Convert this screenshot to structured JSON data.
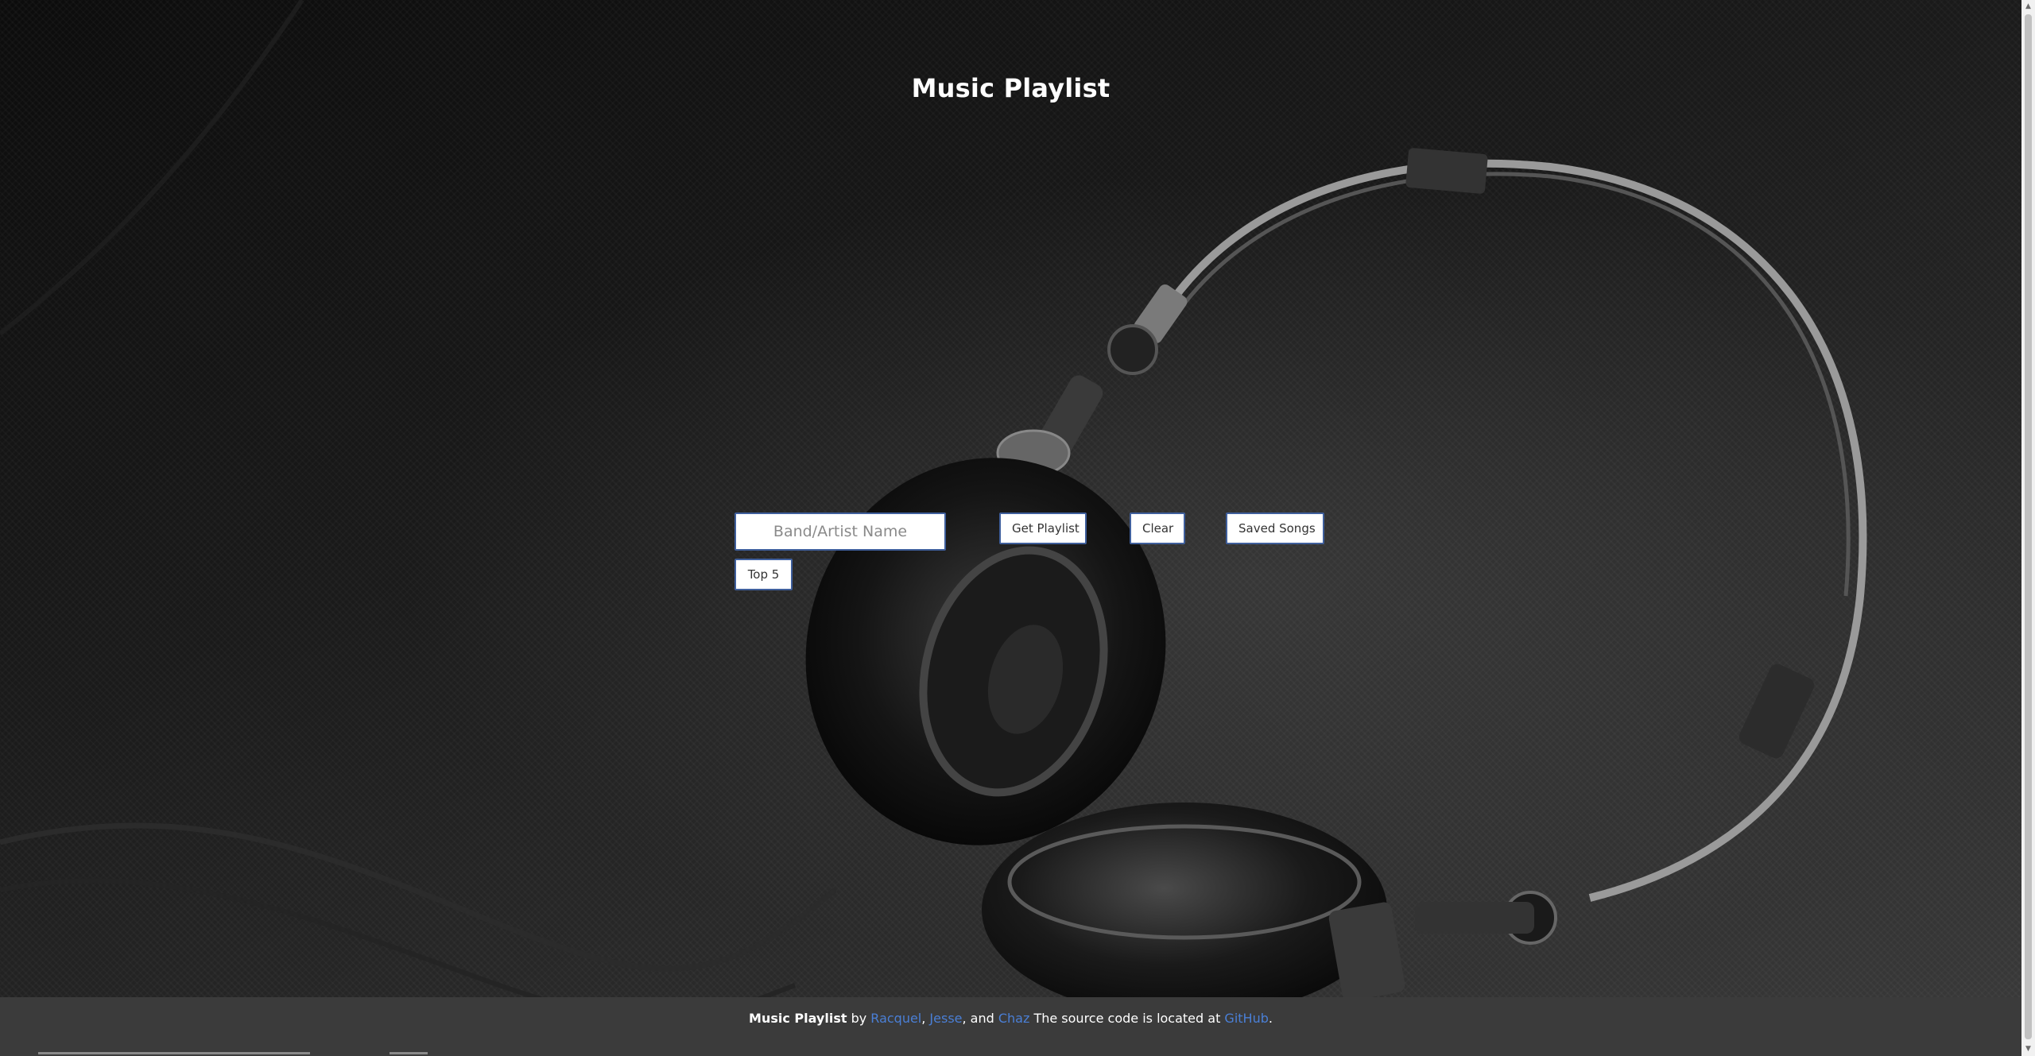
{
  "page": {
    "title": "Music Playlist"
  },
  "search": {
    "placeholder": "Band/Artist Name",
    "value": ""
  },
  "buttons": {
    "get_playlist": "Get Playlist",
    "clear": "Clear",
    "saved_songs": "Saved Songs",
    "top5": "Top 5"
  },
  "footer": {
    "app_name": "Music Playlist",
    "by": " by ",
    "author1": "Racquel",
    "sep1": ", ",
    "author2": "Jesse",
    "sep2": ", and ",
    "author3": "Chaz",
    "source_text": " The source code is located at ",
    "github_link": "GitHub",
    "end": "."
  },
  "colors": {
    "link": "#4a7fd6",
    "button_border": "#3f5f9c",
    "footer_bg": "#3b3b3b"
  },
  "icons": {
    "background": "headphones-image"
  }
}
